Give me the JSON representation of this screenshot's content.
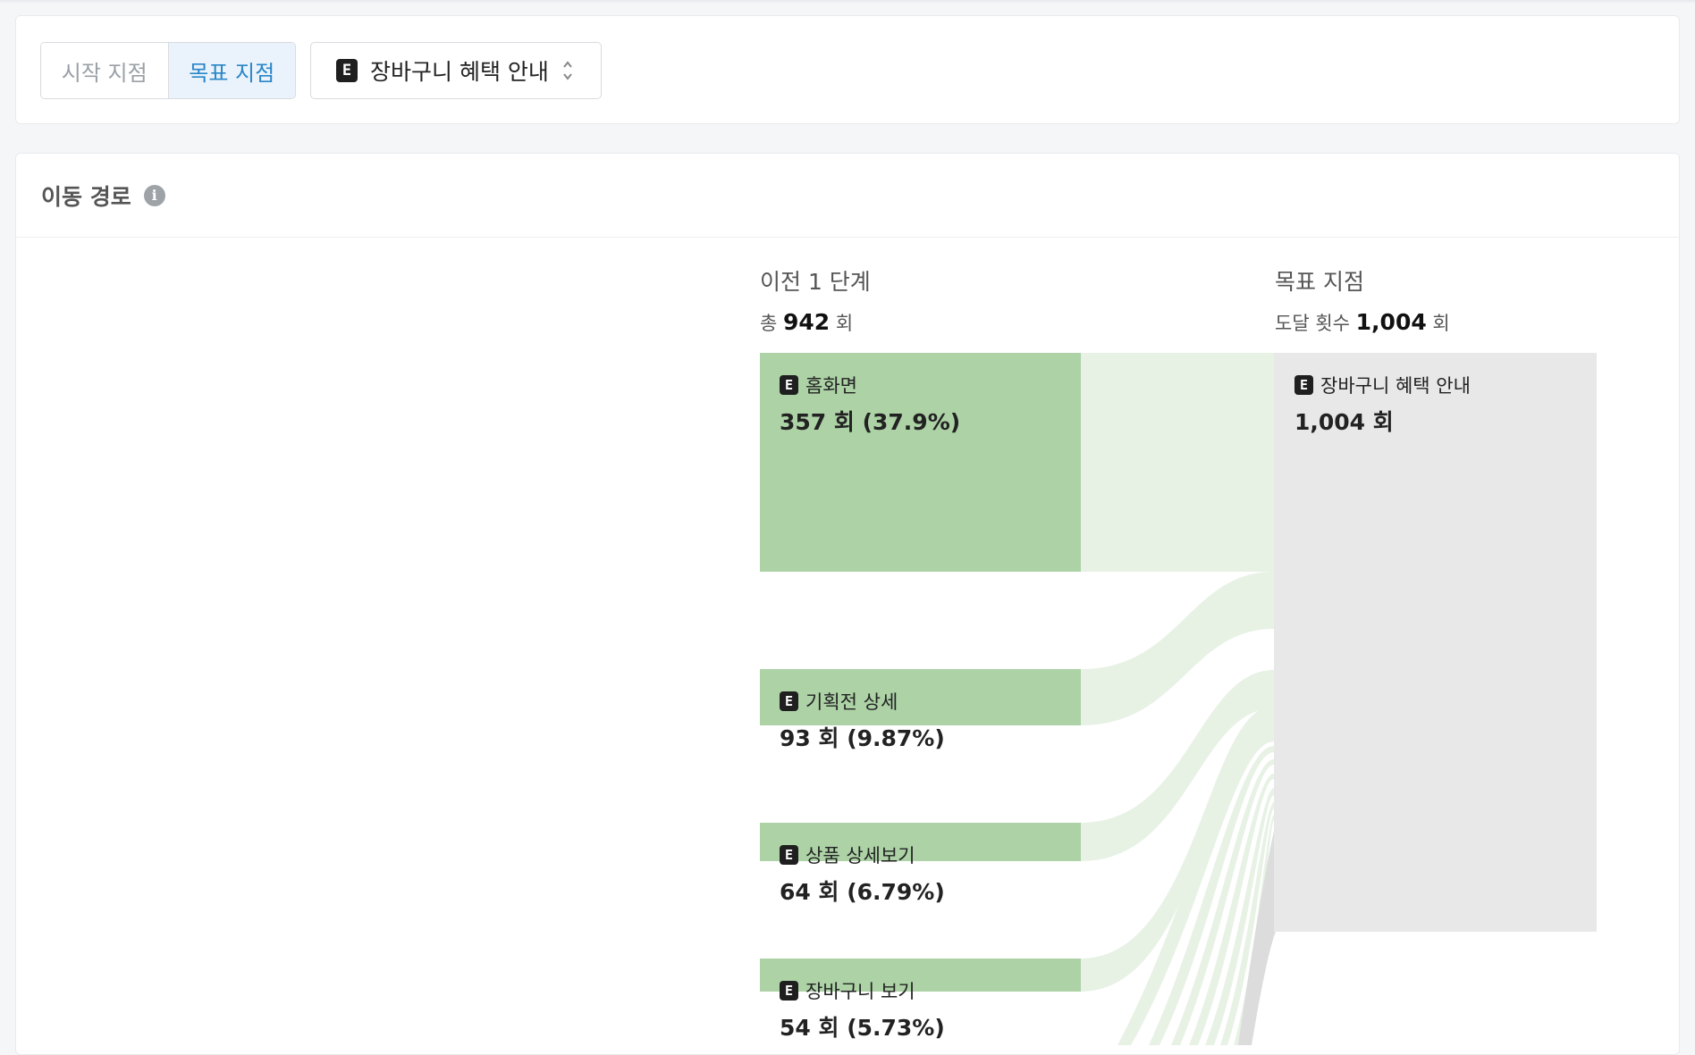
{
  "filter": {
    "tabs": [
      {
        "label": "시작 지점",
        "active": false
      },
      {
        "label": "목표 지점",
        "active": true
      }
    ],
    "event_badge": "E",
    "event_label": "장바구니 혜택 안내",
    "chevron_icon": "chevron-up-down-icon"
  },
  "card": {
    "title": "이동 경로",
    "info_icon": "info-icon"
  },
  "columns": {
    "prev": {
      "title": "이전 1 단계",
      "sub_prefix": "총",
      "total": "942",
      "sub_suffix": "회"
    },
    "target": {
      "title": "목표 지점",
      "sub_prefix": "도달 횟수",
      "total": "1,004",
      "sub_suffix": "회"
    }
  },
  "nodes": [
    {
      "badge": "E",
      "label": "홈화면",
      "count": "357 회 (37.9%)"
    },
    {
      "badge": "E",
      "label": "기획전 상세",
      "count": "93 회 (9.87%)"
    },
    {
      "badge": "E",
      "label": "상품 상세보기",
      "count": "64 회 (6.79%)"
    },
    {
      "badge": "E",
      "label": "장바구니 보기",
      "count": "54 회 (5.73%)"
    }
  ],
  "target_node": {
    "badge": "E",
    "label": "장바구니 혜택 안내",
    "count": "1,004 회"
  },
  "colors": {
    "node_fill": "#acd2a6",
    "flow_fill": "#e7f2e5",
    "target_fill": "#e8e8e8",
    "active_tab": "#2a86c8"
  }
}
